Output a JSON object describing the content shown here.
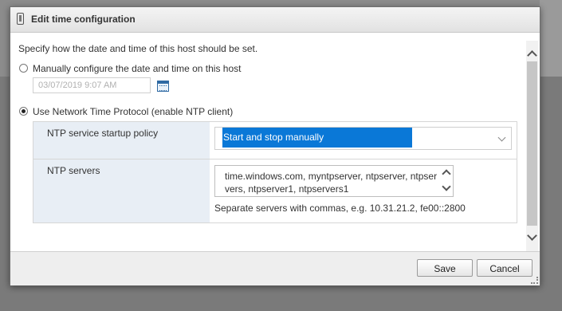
{
  "dialog": {
    "title": "Edit time configuration",
    "intro": "Specify how the date and time of this host should be set.",
    "manual_option_label": "Manually configure the date and time on this host",
    "datetime_value": "03/07/2019 9:07 AM",
    "ntp_option_label": "Use Network Time Protocol (enable NTP client)",
    "selected_option": "ntp",
    "ntp_policy_label": "NTP service startup policy",
    "ntp_policy_value": "Start and stop manually",
    "ntp_servers_label": "NTP servers",
    "ntp_servers_value": "time.windows.com, myntpserver, ntpserver, ntpservers, ntpserver1, ntpservers1",
    "ntp_servers_hint": "Separate servers with commas, e.g. 10.31.21.2, fe00::2800"
  },
  "footer": {
    "save_label": "Save",
    "cancel_label": "Cancel"
  },
  "icons": [
    "dialog-app-icon",
    "calendar-icon",
    "chevron-down-icon",
    "scroll-up-icon",
    "scroll-down-icon",
    "resize-grip-icon"
  ],
  "colors": {
    "selection": "#0a78d7",
    "label_cell": "#e8eef5"
  }
}
